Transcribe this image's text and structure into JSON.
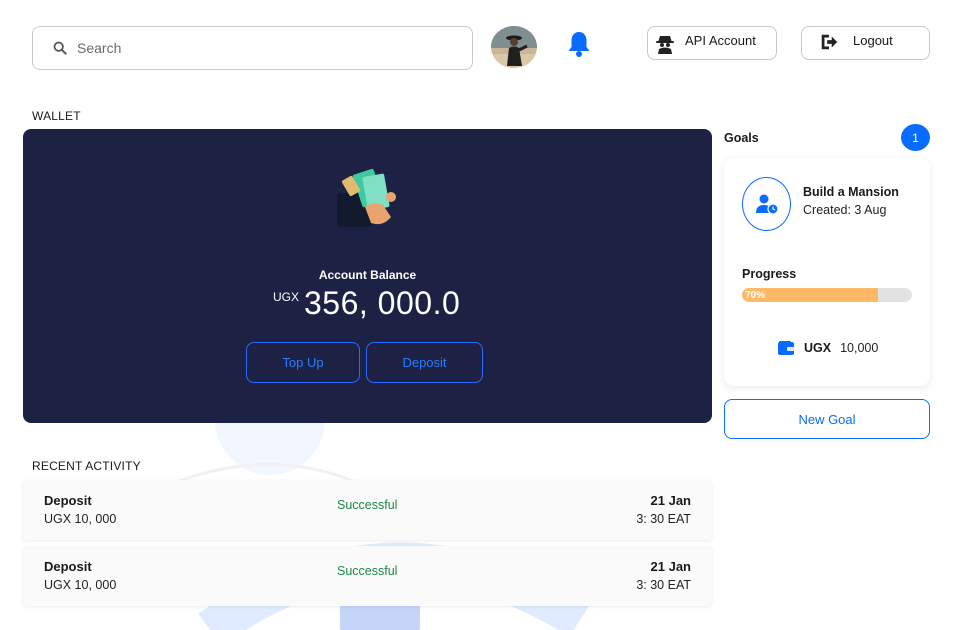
{
  "header": {
    "search_placeholder": "Search",
    "api_account_label": "API Account",
    "logout_label": "Logout"
  },
  "wallet": {
    "section_label": "WALLET",
    "balance_title": "Account Balance",
    "currency": "UGX",
    "balance": "356, 000.0",
    "topup_label": "Top Up",
    "deposit_label": "Deposit",
    "card_color": "#1d2245"
  },
  "activity": {
    "section_label": "RECENT ACTIVITY",
    "items": [
      {
        "type": "Deposit",
        "amount": "UGX 10, 000",
        "status": "Successful",
        "date": "21 Jan",
        "time": "3: 30 EAT"
      },
      {
        "type": "Deposit",
        "amount": "UGX 10, 000",
        "status": "Successful",
        "date": "21 Jan",
        "time": "3: 30 EAT"
      }
    ]
  },
  "goals": {
    "title": "Goals",
    "count": "1",
    "goal": {
      "name": "Build a Mansion",
      "created": "Created: 3 Aug",
      "progress_label": "Progress",
      "progress_text": "70%",
      "progress_fraction": 0.8,
      "currency": "UGX",
      "amount": "10,000"
    },
    "new_goal_label": "New Goal"
  },
  "colors": {
    "accent": "#0a6cff",
    "success": "#1d8a44",
    "progress": "#ffb866"
  }
}
